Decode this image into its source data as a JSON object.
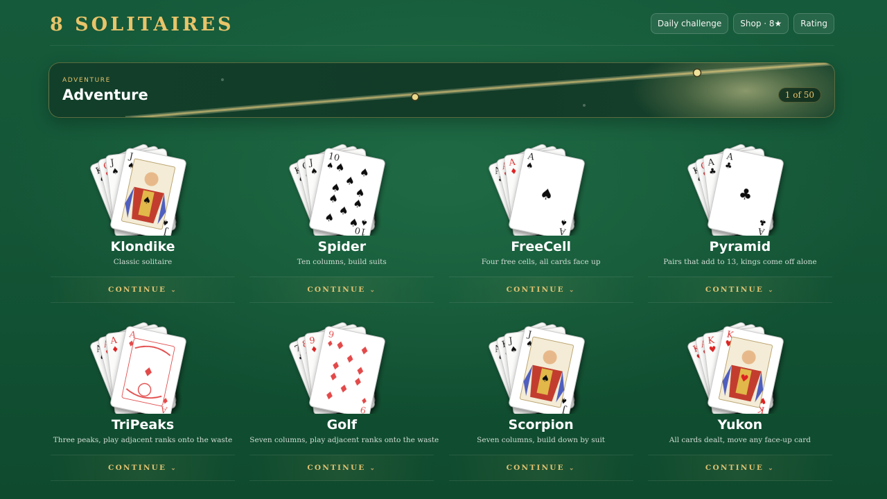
{
  "header": {
    "brand": "8 SOLITAIRES",
    "nav": [
      "Daily challenge",
      "Shop · 8★",
      "Rating"
    ]
  },
  "hero": {
    "kicker": "ADVENTURE",
    "title": "Adventure",
    "progress": "1 of 50"
  },
  "games": [
    {
      "name": "Klondike",
      "desc": "Classic solitaire",
      "action": "CONTINUE",
      "cards": [
        {
          "r": "K",
          "s": "♠",
          "c": "#111"
        },
        {
          "r": "Q",
          "s": "♥",
          "c": "#d22"
        },
        {
          "r": "J",
          "s": "♠",
          "c": "#111"
        }
      ],
      "front": {
        "type": "face",
        "r": "J",
        "s": "♠",
        "c": "#111"
      }
    },
    {
      "name": "Spider",
      "desc": "Ten columns, build suits",
      "action": "CONTINUE",
      "cards": [
        {
          "r": "K",
          "s": "♠",
          "c": "#111"
        },
        {
          "r": "Q",
          "s": "♠",
          "c": "#111"
        },
        {
          "r": "J",
          "s": "♠",
          "c": "#111"
        }
      ],
      "front": {
        "type": "pips",
        "r": "10",
        "s": "♠",
        "c": "#111"
      }
    },
    {
      "name": "FreeCell",
      "desc": "Four free cells, all cards face up",
      "action": "CONTINUE",
      "cards": [
        {
          "r": "A",
          "s": "♣",
          "c": "#111"
        },
        {
          "r": "A",
          "s": "♥",
          "c": "#d22"
        },
        {
          "r": "A",
          "s": "♦",
          "c": "#d22"
        }
      ],
      "front": {
        "type": "ace",
        "r": "A",
        "s": "♠",
        "c": "#111"
      }
    },
    {
      "name": "Pyramid",
      "desc": "Pairs that add to 13, kings come off alone",
      "action": "CONTINUE",
      "cards": [
        {
          "r": "K",
          "s": "♠",
          "c": "#111"
        },
        {
          "r": "Q",
          "s": "♥",
          "c": "#d22"
        },
        {
          "r": "A",
          "s": "♣",
          "c": "#111"
        }
      ],
      "front": {
        "type": "ace",
        "r": "A",
        "s": "♣",
        "c": "#111"
      }
    },
    {
      "name": "TriPeaks",
      "desc": "Three peaks, play adjacent ranks onto the waste",
      "action": "CONTINUE",
      "cards": [
        {
          "r": "A",
          "s": "♠",
          "c": "#111"
        },
        {
          "r": "A",
          "s": "♥",
          "c": "#d22"
        },
        {
          "r": "A",
          "s": "♦",
          "c": "#d22"
        }
      ],
      "front": {
        "type": "ornate",
        "r": "A",
        "s": "♦",
        "c": "#e34a4a"
      }
    },
    {
      "name": "Golf",
      "desc": "Seven columns, play adjacent ranks onto the waste",
      "action": "CONTINUE",
      "cards": [
        {
          "r": "7",
          "s": "♣",
          "c": "#111"
        },
        {
          "r": "8",
          "s": "♦",
          "c": "#d22"
        },
        {
          "r": "9",
          "s": "♦",
          "c": "#d22"
        }
      ],
      "front": {
        "type": "pips",
        "r": "9",
        "s": "♦",
        "c": "#e34a4a"
      }
    },
    {
      "name": "Scorpion",
      "desc": "Seven columns, build down by suit",
      "action": "CONTINUE",
      "cards": [
        {
          "r": "A",
          "s": "♠",
          "c": "#111"
        },
        {
          "r": "K",
          "s": "♠",
          "c": "#111"
        },
        {
          "r": "J",
          "s": "♠",
          "c": "#111"
        }
      ],
      "front": {
        "type": "face",
        "r": "J",
        "s": "♠",
        "c": "#111"
      }
    },
    {
      "name": "Yukon",
      "desc": "All cards dealt, move any face-up card",
      "action": "CONTINUE",
      "cards": [
        {
          "r": "K",
          "s": "♥",
          "c": "#d22"
        },
        {
          "r": "A",
          "s": "♥",
          "c": "#d22"
        },
        {
          "r": "K",
          "s": "♥",
          "c": "#d22"
        }
      ],
      "front": {
        "type": "face",
        "r": "K",
        "s": "♥",
        "c": "#d22"
      }
    }
  ],
  "colors": {
    "gold": "#e9c46a",
    "felt": "#155a3a"
  }
}
